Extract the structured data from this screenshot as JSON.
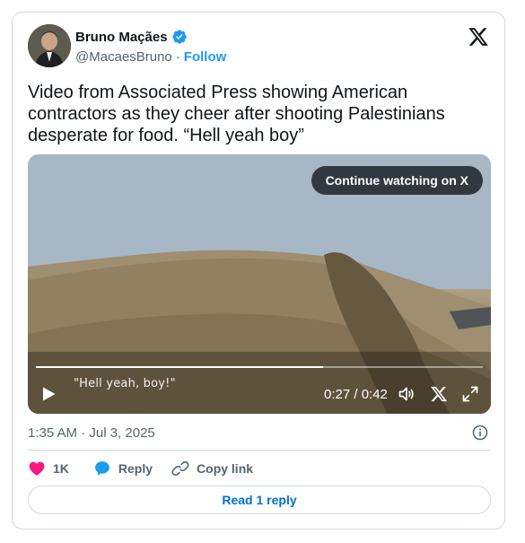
{
  "author": {
    "name": "Bruno Maçães",
    "handle": "@MacaesBruno",
    "separator": "·",
    "follow_label": "Follow"
  },
  "tweet": {
    "text": "Video from Associated Press showing American contractors as they cheer after shooting Palestinians desperate for food. “Hell yeah boy”"
  },
  "video": {
    "continue_label": "Continue watching on X",
    "caption": "\"Hell yeah, boy!\"",
    "time_display": "0:27 / 0:42",
    "progress_fraction": 0.643
  },
  "timestamp": "1:35 AM · Jul 3, 2025",
  "actions": {
    "like_count": "1K",
    "reply_label": "Reply",
    "copy_link_label": "Copy link"
  },
  "read_reply_label": "Read 1 reply",
  "colors": {
    "accent": "#1d9bf0",
    "link": "#006fd6",
    "like": "#f91880",
    "muted": "#536471"
  },
  "icons": [
    "verified-badge-icon",
    "x-logo-icon",
    "play-icon",
    "volume-icon",
    "x-icon",
    "fullscreen-icon",
    "info-icon",
    "heart-icon",
    "speech-bubble-icon",
    "link-icon"
  ]
}
